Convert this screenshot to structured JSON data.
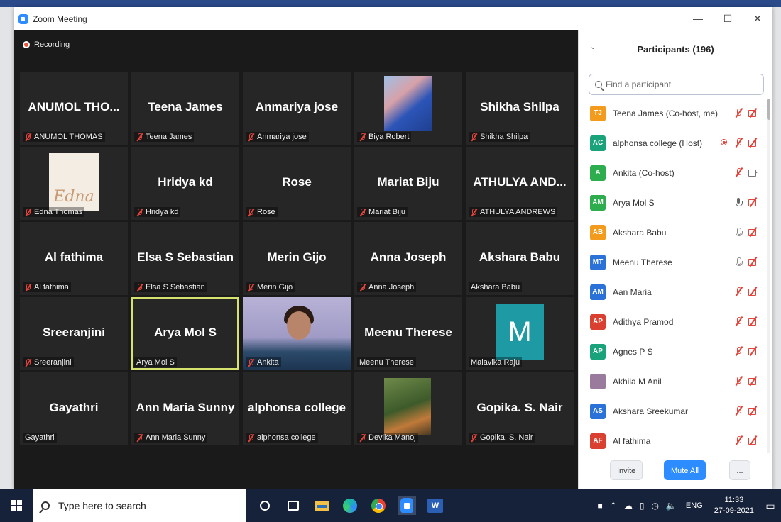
{
  "window": {
    "title": "Zoom Meeting",
    "controls": {
      "minimize": "—",
      "maximize": "☐",
      "close": "✕"
    }
  },
  "meeting": {
    "recording_label": "Recording",
    "tiles": [
      {
        "display": "ANUMOL THO...",
        "label": "ANUMOL THOMAS",
        "muted": true
      },
      {
        "display": "Teena James",
        "label": "Teena James",
        "muted": true
      },
      {
        "display": "Anmariya jose",
        "label": "Anmariya jose",
        "muted": true
      },
      {
        "display": "",
        "label": "Biya Robert",
        "muted": true,
        "photo": "couple-photo"
      },
      {
        "display": "Shikha Shilpa",
        "label": "Shikha Shilpa",
        "muted": true
      },
      {
        "display": "",
        "label": "Edna Thomas",
        "muted": true,
        "photo": "edna-photo",
        "photo_text": "Edna"
      },
      {
        "display": "Hridya kd",
        "label": "Hridya kd",
        "muted": true
      },
      {
        "display": "Rose",
        "label": "Rose",
        "muted": true
      },
      {
        "display": "Mariat Biju",
        "label": "Mariat Biju",
        "muted": true
      },
      {
        "display": "ATHULYA AND...",
        "label": "ATHULYA ANDREWS",
        "muted": true
      },
      {
        "display": "Al fathima",
        "label": "Al fathima",
        "muted": true
      },
      {
        "display": "Elsa S Sebastian",
        "label": "Elsa S Sebastian",
        "muted": true
      },
      {
        "display": "Merin Gijo",
        "label": "Merin Gijo",
        "muted": true
      },
      {
        "display": "Anna Joseph",
        "label": "Anna Joseph",
        "muted": true
      },
      {
        "display": "Akshara Babu",
        "label": "Akshara Babu",
        "muted": false
      },
      {
        "display": "Sreeranjini",
        "label": "Sreeranjini",
        "muted": true
      },
      {
        "display": "Arya Mol S",
        "label": "Arya Mol S",
        "muted": false,
        "active_speaker": true
      },
      {
        "display": "",
        "label": "Ankita",
        "muted": true,
        "photo": "ankita-video"
      },
      {
        "display": "Meenu Therese",
        "label": "Meenu Therese",
        "muted": false
      },
      {
        "display": "",
        "label": "Malavika Raju",
        "muted": false,
        "photo": "letter-avatar",
        "photo_text": "M"
      },
      {
        "display": "Gayathri",
        "label": "Gayathri",
        "muted": false
      },
      {
        "display": "Ann Maria Sunny",
        "label": "Ann Maria Sunny",
        "muted": true
      },
      {
        "display": "alphonsa college",
        "label": "alphonsa college",
        "muted": true
      },
      {
        "display": "",
        "label": "Devika Manoj",
        "muted": true,
        "photo": "devika-photo"
      },
      {
        "display": "Gopika. S. Nair",
        "label": "Gopika. S. Nair",
        "muted": true
      }
    ]
  },
  "participants": {
    "title": "Participants (196)",
    "search_placeholder": "Find a participant",
    "items": [
      {
        "initials": "TJ",
        "color": "#f29b1d",
        "name": "Teena James (Co-host, me)",
        "icons": [
          "mic-off",
          "video-off"
        ]
      },
      {
        "initials": "AC",
        "color": "#1aa37a",
        "name": "alphonsa college (Host)",
        "icons": [
          "record",
          "mic-off",
          "video-off"
        ]
      },
      {
        "initials": "A",
        "color": "#2dad4e",
        "name": "Ankita (Co-host)",
        "icons": [
          "mic-off",
          "video"
        ]
      },
      {
        "initials": "AM",
        "color": "#2dad4e",
        "name": "Arya Mol S",
        "icons": [
          "mic-on",
          "video-off"
        ]
      },
      {
        "initials": "AB",
        "color": "#f29b1d",
        "name": "Akshara Babu",
        "icons": [
          "mic",
          "video-off"
        ]
      },
      {
        "initials": "MT",
        "color": "#2a72d8",
        "name": "Meenu Therese",
        "icons": [
          "mic",
          "video-off"
        ]
      },
      {
        "initials": "AM",
        "color": "#2a72d8",
        "name": "Aan Maria",
        "icons": [
          "mic-off",
          "video-off"
        ]
      },
      {
        "initials": "AP",
        "color": "#d9402f",
        "name": "Adithya Pramod",
        "icons": [
          "mic-off",
          "video-off"
        ]
      },
      {
        "initials": "AP",
        "color": "#1aa37a",
        "name": "Agnes P S",
        "icons": [
          "mic-off",
          "video-off"
        ]
      },
      {
        "initials": "",
        "color": "#9a7b9e",
        "name": "Akhila M Anil",
        "icons": [
          "mic-off",
          "video-off"
        ]
      },
      {
        "initials": "AS",
        "color": "#2a72d8",
        "name": "Akshara Sreekumar",
        "icons": [
          "mic-off",
          "video-off"
        ]
      },
      {
        "initials": "AF",
        "color": "#d9402f",
        "name": "Al fathima",
        "icons": [
          "mic-off",
          "video-off"
        ]
      }
    ],
    "footer": {
      "invite": "Invite",
      "mute_all": "Mute All",
      "more": "..."
    }
  },
  "taskbar": {
    "search_placeholder": "Type here to search",
    "lang": "ENG",
    "time": "11:33",
    "date": "27-09-2021",
    "notifications_count": "1"
  }
}
